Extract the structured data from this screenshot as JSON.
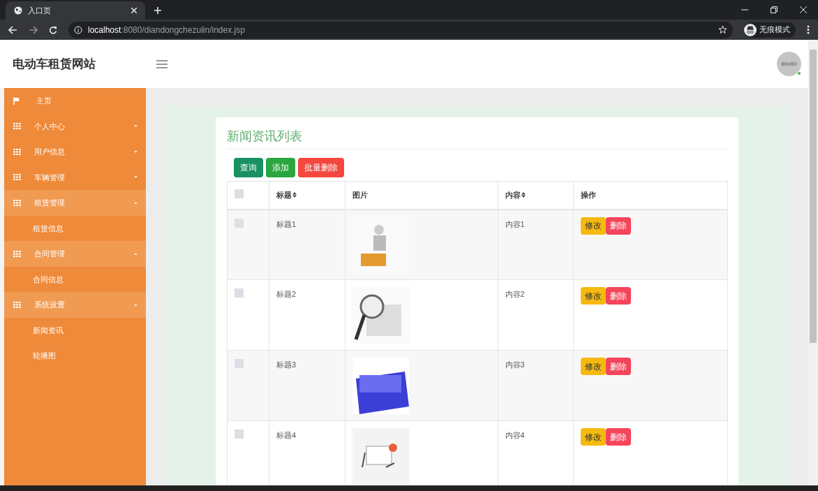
{
  "browser": {
    "tab_title": "入口页",
    "url_host": "localhost",
    "url_rest": ":8080/diandongchezulin/index.jsp",
    "incognito_label": "无痕模式"
  },
  "header": {
    "site_title": "电动车租赁网站",
    "avatar_text": "80x80"
  },
  "sidebar": {
    "items": [
      {
        "label": "主页",
        "kind": "home"
      },
      {
        "label": "个人中心",
        "kind": "group",
        "expanded": false
      },
      {
        "label": "用户信息",
        "kind": "group",
        "expanded": false
      },
      {
        "label": "车辆管理",
        "kind": "group",
        "expanded": false
      },
      {
        "label": "租赁管理",
        "kind": "group",
        "expanded": true,
        "children": [
          {
            "label": "租赁信息"
          }
        ]
      },
      {
        "label": "合同管理",
        "kind": "group",
        "expanded": true,
        "children": [
          {
            "label": "合同信息"
          }
        ]
      },
      {
        "label": "系统设置",
        "kind": "group",
        "expanded": true,
        "children": [
          {
            "label": "新闻资讯"
          },
          {
            "label": "轮播图"
          }
        ]
      }
    ]
  },
  "panel": {
    "title": "新闻资讯列表",
    "buttons": [
      {
        "label": "查询",
        "kind": "search"
      },
      {
        "label": "添加",
        "kind": "add"
      },
      {
        "label": "批量删除",
        "kind": "delete"
      }
    ]
  },
  "table": {
    "select_all_checked": false,
    "columns": [
      {
        "kind": "check"
      },
      {
        "label": "标题",
        "sortable": true
      },
      {
        "label": "图片",
        "sortable": false
      },
      {
        "label": "内容",
        "sortable": true
      },
      {
        "label": "操作",
        "sortable": false
      }
    ],
    "rows": [
      {
        "checked": false,
        "title": "标题1",
        "content": "内容1",
        "actions": [
          "修改",
          "删除"
        ]
      },
      {
        "checked": false,
        "title": "标题2",
        "content": "内容2",
        "actions": [
          "修改",
          "删除"
        ]
      },
      {
        "checked": false,
        "title": "标题3",
        "content": "内容3",
        "actions": [
          "修改",
          "删除"
        ]
      },
      {
        "checked": false,
        "title": "标题4",
        "content": "内容4",
        "actions": [
          "修改",
          "删除"
        ]
      }
    ]
  }
}
